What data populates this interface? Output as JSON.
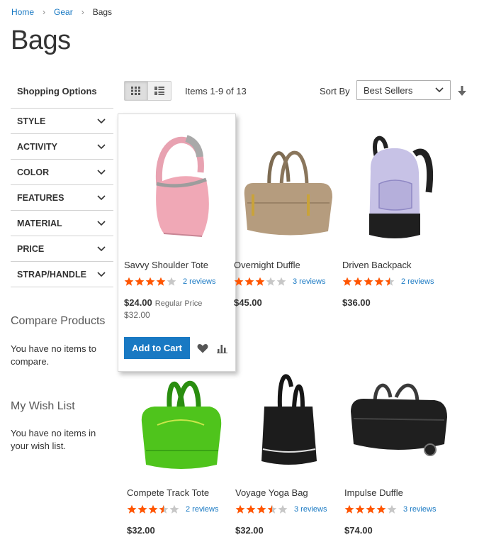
{
  "breadcrumbs": [
    {
      "label": "Home"
    },
    {
      "label": "Gear"
    },
    {
      "label": "Bags"
    }
  ],
  "page_title": "Bags",
  "sidebar": {
    "title": "Shopping Options",
    "filters": [
      "STYLE",
      "ACTIVITY",
      "COLOR",
      "FEATURES",
      "MATERIAL",
      "PRICE",
      "STRAP/HANDLE"
    ],
    "compare": {
      "title": "Compare Products",
      "text": "You have no items to compare."
    },
    "wishlist": {
      "title": "My Wish List",
      "text": "You have no items in your wish list."
    }
  },
  "toolbar": {
    "items_count": "Items 1-9 of 13",
    "sort_label": "Sort By",
    "sort_value": "Best Sellers",
    "view_mode": "grid"
  },
  "products": [
    {
      "name": "Savvy Shoulder Tote",
      "rating": 4,
      "reviews": "2 reviews",
      "price": "$24.00",
      "regular_label": "Regular Price",
      "old_price": "$32.00",
      "add_to_cart": "Add to Cart",
      "image": "pink-shoulder-tote"
    },
    {
      "name": "Overnight Duffle",
      "rating": 3,
      "reviews": "3 reviews",
      "price": "$45.00",
      "image": "tan-duffle"
    },
    {
      "name": "Driven Backpack",
      "rating": 4.5,
      "reviews": "2 reviews",
      "price": "$36.00",
      "image": "lavender-backpack"
    },
    {
      "name": "Compete Track Tote",
      "rating": 3.5,
      "reviews": "2 reviews",
      "price": "$32.00",
      "image": "green-track-tote"
    },
    {
      "name": "Voyage Yoga Bag",
      "rating": 3.5,
      "reviews": "3 reviews",
      "price": "$32.00",
      "image": "black-yoga-bag"
    },
    {
      "name": "Impulse Duffle",
      "rating": 4,
      "reviews": "3 reviews",
      "price": "$74.00",
      "image": "black-rolling-duffle"
    }
  ],
  "colors": {
    "link": "#1979c3",
    "star": "#ff5501",
    "star_empty": "#c7c7c7",
    "button": "#1979c3"
  }
}
